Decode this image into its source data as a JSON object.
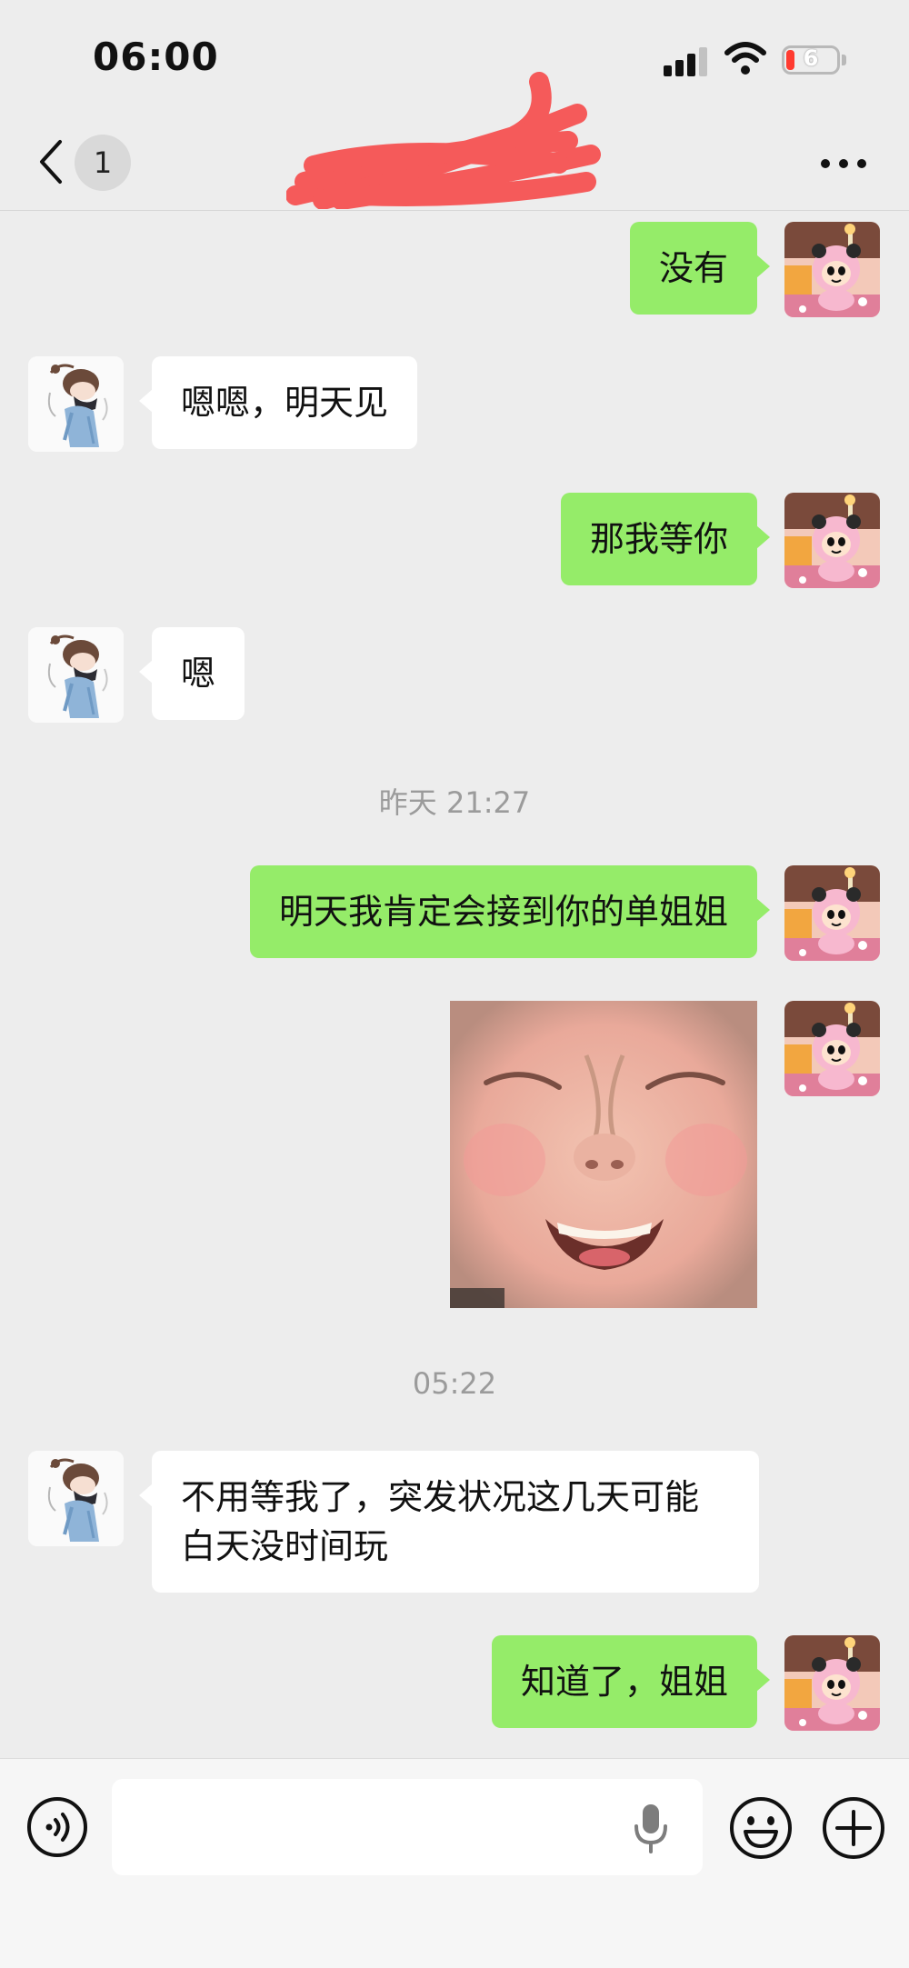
{
  "status_bar": {
    "time": "06:00",
    "battery_level": "6",
    "icons": [
      "cellular-signal-icon",
      "wifi-icon",
      "battery-icon"
    ]
  },
  "nav": {
    "back_icon": "chevron-left-icon",
    "unread_count": "1",
    "title_redacted": true,
    "more_icon": "more-dots-icon"
  },
  "messages": [
    {
      "sender": "me",
      "type": "text",
      "text": "没有"
    },
    {
      "sender": "other",
      "type": "text",
      "text": "嗯嗯，明天见"
    },
    {
      "sender": "me",
      "type": "text",
      "text": "那我等你"
    },
    {
      "sender": "other",
      "type": "text",
      "text": "嗯"
    },
    {
      "type": "timestamp",
      "text": "昨天 21:27"
    },
    {
      "sender": "me",
      "type": "text",
      "text": "明天我肯定会接到你的单姐姐"
    },
    {
      "sender": "me",
      "type": "sticker",
      "sticker": "laughing-child-face"
    },
    {
      "type": "timestamp",
      "text": "05:22"
    },
    {
      "sender": "other",
      "type": "text",
      "text": "不用等我了，突发状况这几天可能白天没时间玩"
    },
    {
      "sender": "me",
      "type": "text",
      "text": "知道了，姐姐"
    }
  ],
  "input_bar": {
    "value": "",
    "placeholder": "",
    "icons": [
      "voice-mode-icon",
      "microphone-icon",
      "emoji-icon",
      "add-icon"
    ]
  },
  "colors": {
    "background": "#ededed",
    "my_bubble": "#95ec69",
    "other_bubble": "#ffffff",
    "timestamp_text": "#9b9b9b",
    "redaction": "#f55a5a",
    "battery_low": "#ff3b30"
  }
}
